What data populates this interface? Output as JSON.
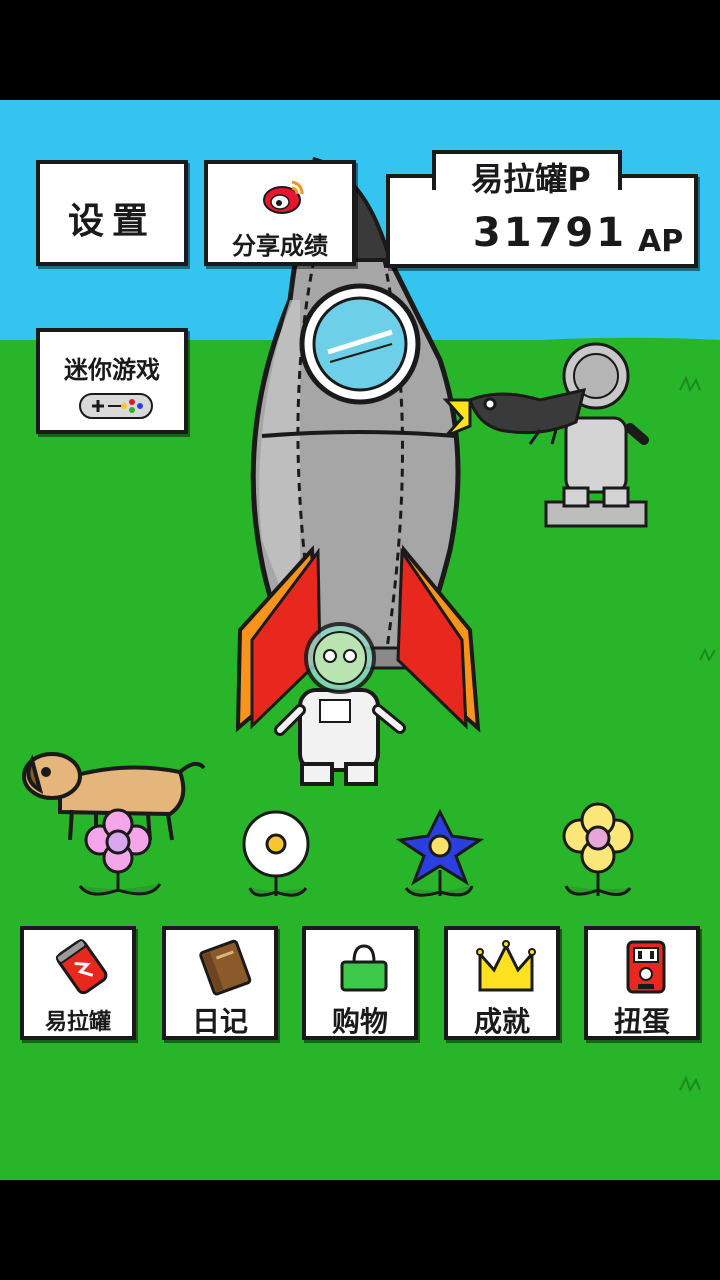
{
  "top": {
    "settings_label": "设置",
    "share_label": "分享成绩",
    "mini_game_label": "迷你游戏"
  },
  "points": {
    "title": "易拉罐P",
    "value": "31791",
    "unit": "AP"
  },
  "bottom_menu": [
    {
      "label": "易拉罐",
      "icon": "soda-can-icon"
    },
    {
      "label": "日记",
      "icon": "diary-book-icon"
    },
    {
      "label": "购物",
      "icon": "shopping-bag-icon"
    },
    {
      "label": "成就",
      "icon": "crown-icon"
    },
    {
      "label": "扭蛋",
      "icon": "gacha-machine-icon"
    }
  ],
  "colors": {
    "sky": "#35C4EF",
    "grass": "#29B52A",
    "accent_red": "#E8271F",
    "weibo_red": "#E6162D"
  }
}
